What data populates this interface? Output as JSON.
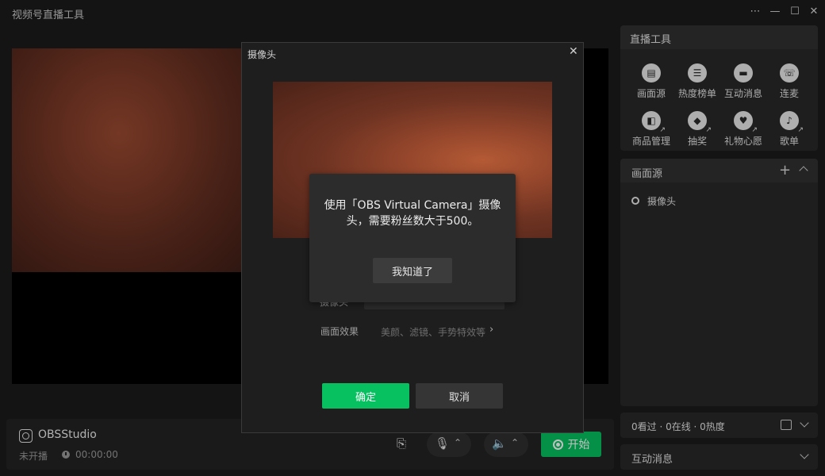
{
  "app": {
    "title": "视频号直播工具",
    "window_controls": [
      "⋯",
      "—",
      "☐",
      "✕"
    ]
  },
  "preview": {},
  "bottom_bar": {
    "stream_name": "OBSStudio",
    "status": "未开播",
    "elapsed": "00:00:00",
    "start_label": "开始"
  },
  "tools": {
    "title": "直播工具",
    "items": [
      {
        "label": "画面源",
        "icon": "picture-source-icon",
        "glyph": "▤"
      },
      {
        "label": "热度榜单",
        "icon": "list-icon",
        "glyph": "☰"
      },
      {
        "label": "互动消息",
        "icon": "chat-icon",
        "glyph": "▬"
      },
      {
        "label": "连麦",
        "icon": "phone-link-icon",
        "glyph": "☏"
      },
      {
        "label": "商品管理",
        "icon": "shopping-bag-icon",
        "glyph": "◧"
      },
      {
        "label": "抽奖",
        "icon": "lottery-icon",
        "glyph": "◆"
      },
      {
        "label": "礼物心愿",
        "icon": "gift-heart-icon",
        "glyph": "♥"
      },
      {
        "label": "歌单",
        "icon": "microphone-icon",
        "glyph": "♪"
      }
    ]
  },
  "sources": {
    "title": "画面源",
    "items": [
      "摄像头"
    ]
  },
  "stats": {
    "text": "0看过 · 0在线 · 0热度"
  },
  "messages": {
    "title": "互动消息"
  },
  "camera_dialog": {
    "title": "摄像头",
    "device_label": "摄像头",
    "effect_label": "画面效果",
    "effect_value": "美颜、滤镜、手势特效等",
    "confirm": "确定",
    "cancel": "取消"
  },
  "alert": {
    "message": "使用「OBS Virtual Camera」摄像头，需要粉丝数大于500。",
    "button": "我知道了"
  },
  "colors": {
    "accent": "#07c160",
    "background": "#1b1b1b",
    "panel": "#282828"
  }
}
